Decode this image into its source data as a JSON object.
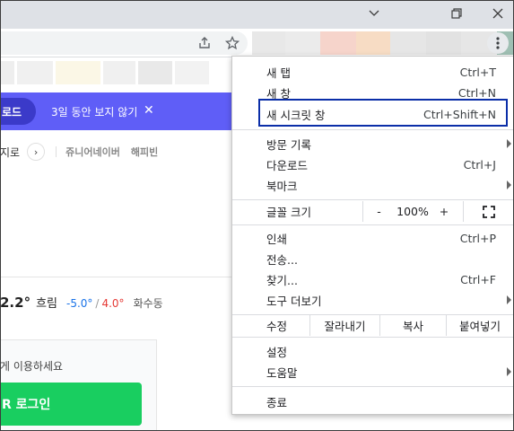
{
  "window": {
    "controls": [
      "minimize",
      "restore",
      "close"
    ]
  },
  "toolbar": {
    "share_icon": "share-icon",
    "bookmark_icon": "star-icon",
    "extension_colors": [
      "#e8e8e8",
      "#ebebeb",
      "#f6d4cb",
      "#f7dcc4",
      "#e6e6e6",
      "#e2e2e2",
      "#e6e6e6",
      "#9fbfb3"
    ]
  },
  "page": {
    "banner": {
      "button_label": "로드",
      "hide_text": "3일 동안 보지 않기"
    },
    "nav": {
      "item": "지로",
      "chevron": "›",
      "links": [
        "쥬니어네이버",
        "해피빈"
      ]
    },
    "weather": {
      "temp": "2.2°",
      "condition": "흐림",
      "low": "-5.0°",
      "separator": "/",
      "high": "4.0°",
      "location": "화수동"
    },
    "login": {
      "hint": "게 이용하세요",
      "button_label": "R 로그인"
    }
  },
  "menu": {
    "group1": [
      {
        "label": "새 탭",
        "shortcut": "Ctrl+T"
      },
      {
        "label": "새 창",
        "shortcut": "Ctrl+N"
      },
      {
        "label": "새 시크릿 창",
        "shortcut": "Ctrl+Shift+N"
      }
    ],
    "group2": [
      {
        "label": "방문 기록",
        "shortcut": ""
      },
      {
        "label": "다운로드",
        "shortcut": "Ctrl+J"
      },
      {
        "label": "북마크",
        "shortcut": ""
      }
    ],
    "zoom": {
      "label": "글꼴 크기",
      "minus": "-",
      "value": "100%",
      "plus": "+"
    },
    "group3": [
      {
        "label": "인쇄",
        "shortcut": "Ctrl+P"
      },
      {
        "label": "전송...",
        "shortcut": ""
      },
      {
        "label": "찾기...",
        "shortcut": "Ctrl+F"
      },
      {
        "label": "도구 더보기",
        "shortcut": ""
      }
    ],
    "edit": {
      "label": "수정",
      "cut": "잘라내기",
      "copy": "복사",
      "paste": "붙여넣기"
    },
    "group4": [
      {
        "label": "설정",
        "shortcut": ""
      },
      {
        "label": "도움말",
        "shortcut": ""
      }
    ],
    "exit": {
      "label": "종료"
    }
  },
  "colors": {
    "banner": "#5f5ef7",
    "login_green": "#19ce60",
    "highlight_border": "#0b2ea8",
    "temp_low": "#1a73e8",
    "temp_high": "#e53935"
  }
}
